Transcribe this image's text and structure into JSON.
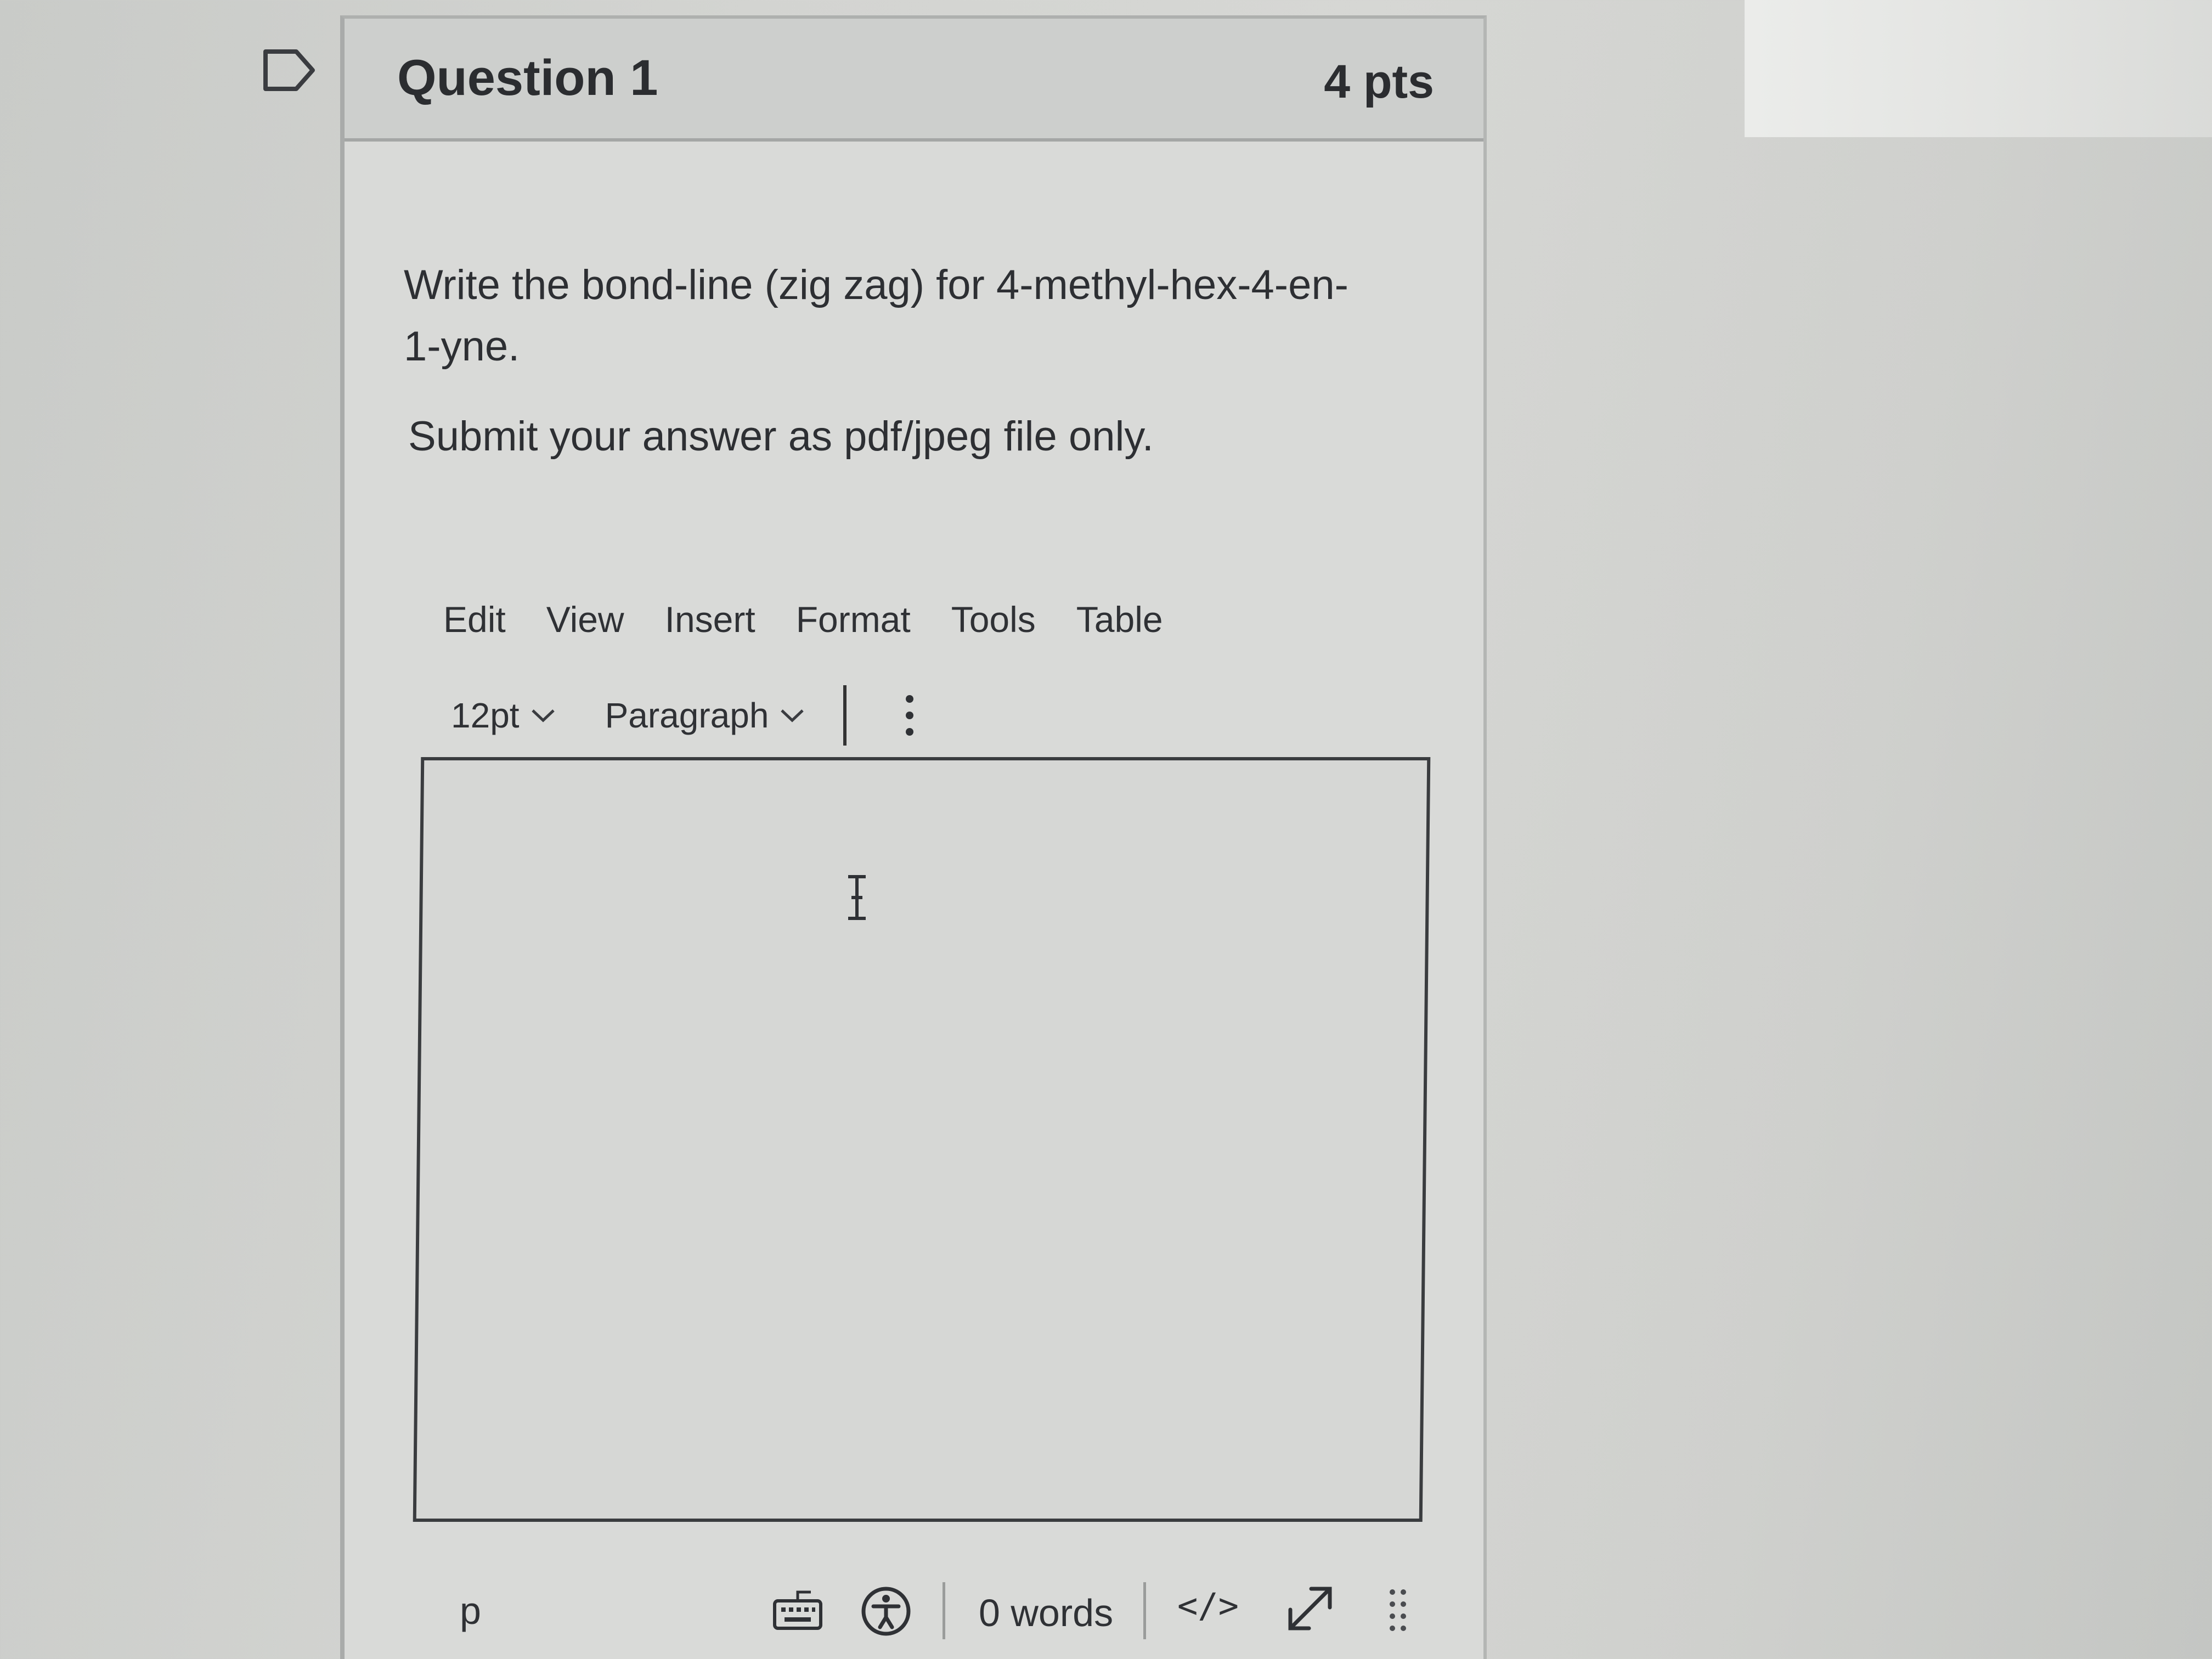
{
  "question": {
    "title": "Question 1",
    "points": "4 pts",
    "text": "Write the bond-line (zig zag) for 4-methyl-hex-4-en-1-yne.",
    "instruction": "Submit your answer as pdf/jpeg file only."
  },
  "editor": {
    "menu": [
      "Edit",
      "View",
      "Insert",
      "Format",
      "Tools",
      "Table"
    ],
    "toolbar": {
      "font_size": "12pt",
      "block_format": "Paragraph"
    },
    "content": "",
    "statusbar": {
      "path": "p",
      "word_count": "0 words",
      "html_toggle": "</>"
    }
  },
  "icons": {
    "flag": "bookmark-flag-icon",
    "more": "vertical-ellipsis-icon",
    "cursor": "text-cursor-icon",
    "keyboard": "keyboard-icon",
    "accessibility": "accessibility-checker-icon",
    "fullscreen": "fullscreen-arrow-icon",
    "resize": "drag-handle-icon"
  }
}
